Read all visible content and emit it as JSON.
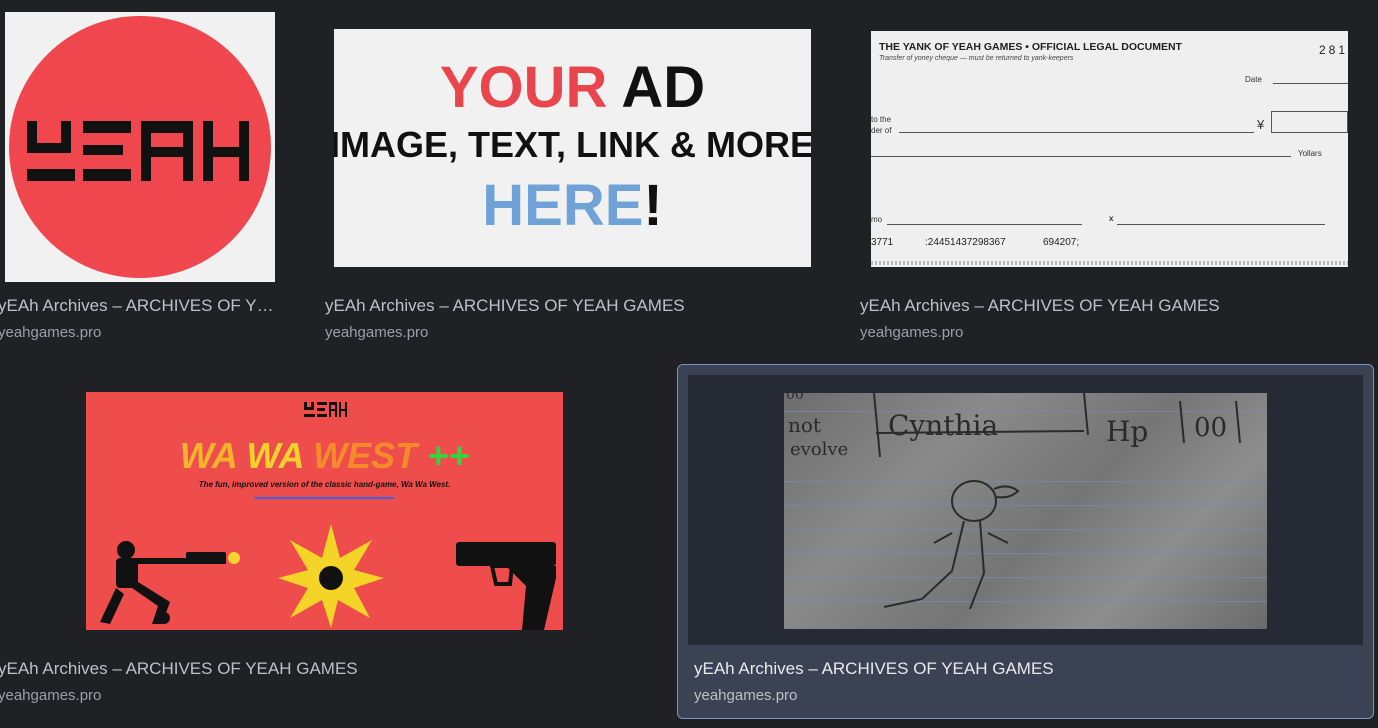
{
  "results": [
    {
      "title": "yEAh Archives – ARCHIVES OF YEAH GAMES",
      "source": "yeahgames.pro",
      "thumb_logo_text": "yEAH"
    },
    {
      "title": "yEAh Archives – ARCHIVES OF YEAH GAMES",
      "source": "yeahgames.pro",
      "ad": {
        "your": "YOUR",
        "ad": "AD",
        "line2": "IMAGE, TEXT, LINK & MORE",
        "here": "HERE",
        "bang": "!"
      }
    },
    {
      "title": "yEAh Archives – ARCHIVES OF YEAH GAMES",
      "source": "yeahgames.pro",
      "cheque": {
        "header": "THE YANK OF YEAH GAMES • OFFICIAL LEGAL DOCUMENT",
        "subheader": "Transfer of yoney cheque — must be returned to yank-keepers",
        "number": "281",
        "date_label": "Date",
        "order_label_1": "to the",
        "order_label_2": "der of",
        "currency": "¥",
        "yollars": "Yollars",
        "memo": "mo",
        "sign_mark": "x",
        "micr_1": "3771",
        "micr_2": ":24451437298367",
        "micr_3": "694207;"
      }
    },
    {
      "title": "yEAh Archives – ARCHIVES OF YEAH GAMES",
      "source": "yeahgames.pro",
      "game": {
        "logo": "yEAH",
        "title_1": "WA",
        "title_2": "WA",
        "title_3": "WEST",
        "title_4": "++",
        "subtitle": "The fun, improved version of the classic hand-game, Wa Wa West."
      }
    },
    {
      "title": "yEAh Archives – ARCHIVES OF YEAH GAMES",
      "source": "yeahgames.pro",
      "selected": true,
      "sketch": {
        "w1": "not",
        "w2": "evolve",
        "w3": "Cynthia",
        "w4": "Hp",
        "w5": "00",
        "w6": "00"
      }
    }
  ],
  "colors": {
    "logo_red": "#ef474d",
    "ad_red": "#e8454c",
    "ad_blue": "#6fa3d8",
    "game_bg": "#ef4c4c",
    "selected_bg": "#3a4253"
  }
}
